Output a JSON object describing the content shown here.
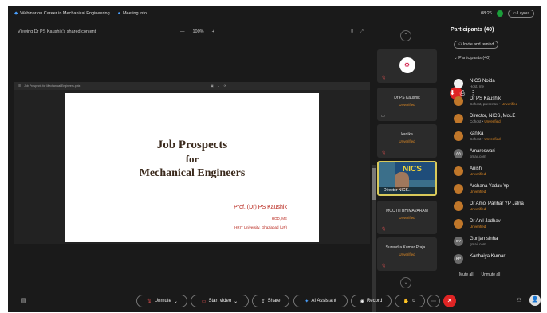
{
  "topbar": {
    "meeting_title": "Webinar on Career in Mechanical Engineering",
    "meeting_info": "Meeting info",
    "time": "08:26",
    "layout_label": "Layout"
  },
  "share": {
    "viewing_text": "Viewing Dr PS Kaushik's shared content",
    "zoom_minus": "—",
    "zoom_level": "100%",
    "zoom_plus": "+"
  },
  "document": {
    "file_name": "Job Prospects for Mechanical Engineers.pptx",
    "title_line1": "Job Prospects",
    "title_line2": "for",
    "title_line3": "Mechanical Engineers",
    "author": "Prof. (Dr) PS Kaushik",
    "role": "HOD, ME",
    "affiliation": "HRIT University, Ghaziabad (UP)"
  },
  "strip": {
    "tiles": [
      {
        "name": "",
        "status": ""
      },
      {
        "name": "Dr PS Kaushik",
        "status": "Unverified"
      },
      {
        "name": "kanika",
        "status": "Unverified"
      },
      {
        "name": "Director NICS...",
        "status": ""
      },
      {
        "name": "MCC ITI BHIMAVARAM",
        "status": "Unverified"
      },
      {
        "name": "Surendra Kumar Praja...",
        "status": "Unverified"
      }
    ],
    "video_wall_text": "NICS"
  },
  "panel": {
    "title": "Participants (40)",
    "invite_label": "Invite and remind",
    "group_label": "Participants (40)",
    "participants": [
      {
        "initials": "",
        "name": "NICS Noida",
        "sub": "Host, me",
        "unverified": ""
      },
      {
        "initials": "",
        "name": "Dr PS Kaushik",
        "sub": "Cohost, presenter •",
        "unverified": "Unverified"
      },
      {
        "initials": "",
        "name": "Director, NICS, MoLE",
        "sub": "Cohost •",
        "unverified": "Unverified"
      },
      {
        "initials": "",
        "name": "kanika",
        "sub": "Cohost •",
        "unverified": "Unverified"
      },
      {
        "initials": "AA",
        "name": "Amareswari",
        "sub": "gmail.com",
        "unverified": ""
      },
      {
        "initials": "",
        "name": "Anish",
        "sub": "",
        "unverified": "Unverified"
      },
      {
        "initials": "",
        "name": "Archana Yadav Yp",
        "sub": "",
        "unverified": "Unverified"
      },
      {
        "initials": "",
        "name": "Dr Amol Parihar YP Jalna",
        "sub": "",
        "unverified": "Unverified"
      },
      {
        "initials": "",
        "name": "Dr Anil Jadhav",
        "sub": "",
        "unverified": "Unverified"
      },
      {
        "initials": "GY",
        "name": "Gunjan sinha",
        "sub": "gmail.com",
        "unverified": ""
      },
      {
        "initials": "KP",
        "name": "Kanhaiya Kumar",
        "sub": "",
        "unverified": ""
      }
    ],
    "mute_all": "Mute all",
    "unmute_all": "Unmute all"
  },
  "bottom": {
    "unmute": "Unmute",
    "start_video": "Start video",
    "share": "Share",
    "ai_assistant": "AI Assistant",
    "record": "Record"
  }
}
